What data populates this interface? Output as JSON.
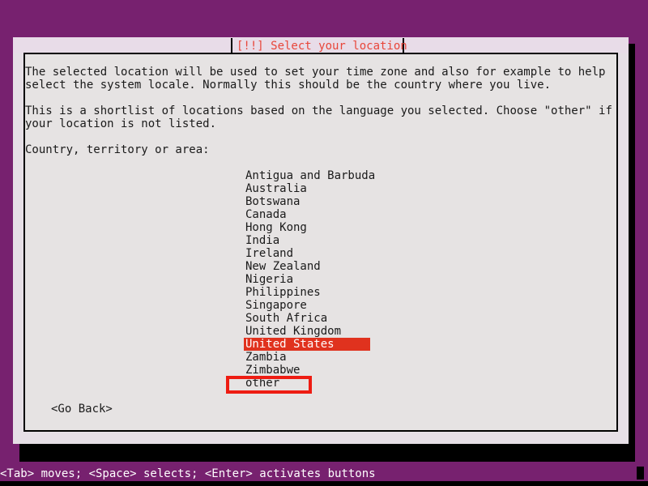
{
  "theme": {
    "desktop_background": "#77216f",
    "dialog_background": "#e6e3e3",
    "title_strip": "#e8dce8",
    "title_color": "#e8463a",
    "selection_background": "#e0321e",
    "selection_text": "#ffffff",
    "annotation_border": "#ee1c12",
    "text_color": "#1a1a1a",
    "status_text": "#ffffff"
  },
  "dialog": {
    "title": "[!!] Select your location",
    "paragraphs": [
      "The selected location will be used to set your time zone and also for example to help\nselect the system locale. Normally this should be the country where you live.",
      "This is a shortlist of locations based on the language you selected. Choose \"other\" if\nyour location is not listed."
    ],
    "prompt_label": "Country, territory or area:",
    "list": {
      "items": [
        "Antigua and Barbuda",
        "Australia",
        "Botswana",
        "Canada",
        "Hong Kong",
        "India",
        "Ireland",
        "New Zealand",
        "Nigeria",
        "Philippines",
        "Singapore",
        "South Africa",
        "United Kingdom",
        "United States",
        "Zambia",
        "Zimbabwe",
        "other"
      ],
      "selected_index": 13,
      "selected_value": "United States",
      "annotated_index": 16,
      "annotated_value": "other"
    },
    "buttons": {
      "go_back": "<Go Back>"
    }
  },
  "status_bar": {
    "hint": "<Tab> moves; <Space> selects; <Enter> activates buttons"
  }
}
